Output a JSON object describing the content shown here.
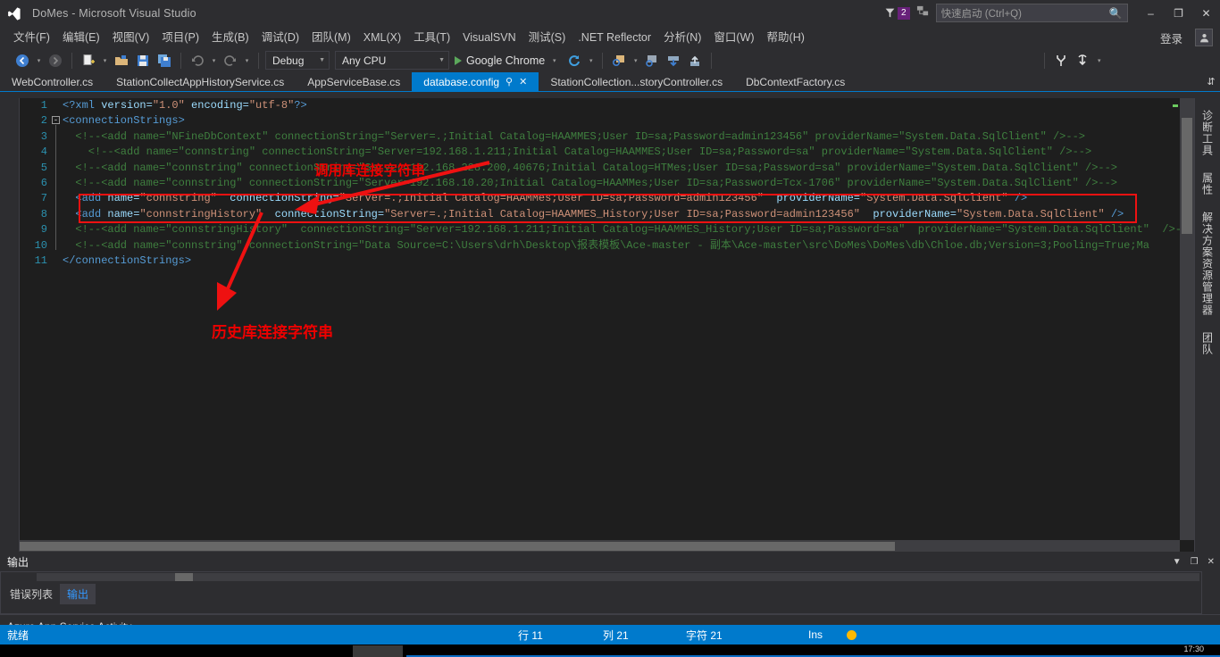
{
  "titlebar": {
    "app_title": "DoMes - Microsoft Visual Studio",
    "logo_icon": "visual-studio-logo-icon",
    "notification_count": "2",
    "notification_icon": "notification-flag-icon",
    "feedback_icon": "send-feedback-icon",
    "quick_launch_placeholder": "快速启动 (Ctrl+Q)",
    "search_icon": "magnifier-icon",
    "minimize": "–",
    "maximize": "❐",
    "close": "✕"
  },
  "menubar": {
    "items": [
      {
        "label": "文件(F)"
      },
      {
        "label": "编辑(E)"
      },
      {
        "label": "视图(V)"
      },
      {
        "label": "项目(P)"
      },
      {
        "label": "生成(B)"
      },
      {
        "label": "调试(D)"
      },
      {
        "label": "团队(M)"
      },
      {
        "label": "XML(X)"
      },
      {
        "label": "工具(T)"
      },
      {
        "label": "VisualSVN"
      },
      {
        "label": "测试(S)"
      },
      {
        "label": ".NET Reflector"
      },
      {
        "label": "分析(N)"
      },
      {
        "label": "窗口(W)"
      },
      {
        "label": "帮助(H)"
      }
    ],
    "signin_label": "登录",
    "account_icon": "account-person-icon"
  },
  "toolbar": {
    "navigate_back_icon": "navigate-back-icon",
    "navigate_forward_icon": "navigate-forward-icon",
    "new_item_icon": "new-item-icon",
    "open_file_icon": "open-file-icon",
    "save_icon": "save-icon",
    "save_all_icon": "save-all-icon",
    "undo_icon": "undo-icon",
    "redo_icon": "redo-icon",
    "config_value": "Debug",
    "platform_value": "Any CPU",
    "run_label": "Google Chrome",
    "run_icon": "play-triangle-icon",
    "refresh_icon": "refresh-circle-icon",
    "step_icon": "step-into-icon",
    "find_window_icon": "find-in-window-icon",
    "download_icon": "download-icon",
    "upload_icon": "upload-icon",
    "branch_icon": "branch-merge-icon",
    "sync_icon": "sync-arrow-icon",
    "overflow_icon": "toolbar-overflow-icon",
    "redacted_field": ""
  },
  "tabs": {
    "items": [
      {
        "label": "WebController.cs",
        "active": false
      },
      {
        "label": "StationCollectAppHistoryService.cs",
        "active": false
      },
      {
        "label": "AppServiceBase.cs",
        "active": false
      },
      {
        "label": "database.config",
        "active": true
      },
      {
        "label": "StationCollection...storyController.cs",
        "active": false
      },
      {
        "label": "DbContextFactory.cs",
        "active": false
      }
    ],
    "pin_icon": "pin-icon",
    "close_icon": "close-tab-icon",
    "overflow_icon": "tab-overflow-chevron-icon"
  },
  "editor": {
    "line_numbers": [
      "1",
      "2",
      "3",
      "4",
      "5",
      "6",
      "7",
      "8",
      "9",
      "10",
      "11"
    ],
    "lines": [
      [
        {
          "t": "<?",
          "c": "tag"
        },
        {
          "t": "xml",
          "c": "tag"
        },
        {
          "t": " version=",
          "c": "attr"
        },
        {
          "t": "\"1.0\"",
          "c": "val"
        },
        {
          "t": " encoding=",
          "c": "attr"
        },
        {
          "t": "\"utf-8\"",
          "c": "val"
        },
        {
          "t": "?>",
          "c": "tag"
        }
      ],
      [
        {
          "t": "<connectionStrings>",
          "c": "tag"
        }
      ],
      [
        {
          "t": "  <!--<add name=\"NFineDbContext\" connectionString=\"Server=.;Initial Catalog=HAAMMES;User ID=sa;Password=admin123456\" providerName=\"System.Data.SqlClient\" />-->",
          "c": "cmt"
        }
      ],
      [
        {
          "t": "    <!--<add name=\"connstring\" connectionString=\"Server=192.168.1.211;Initial Catalog=HAAMMES;User ID=sa;Password=sa\" providerName=\"System.Data.SqlClient\" />-->",
          "c": "cmt"
        }
      ],
      [
        {
          "t": "  <!--<add name=\"connstring\" connectionString=\"Server=192.168.228.200,40676;Initial Catalog=HTMes;User ID=sa;Password=sa\" providerName=\"System.Data.SqlClient\" />-->",
          "c": "cmt"
        }
      ],
      [
        {
          "t": "  <!--<add name=\"connstring\" connectionString=\"Server=192.168.10.20;Initial Catalog=HAAMMes;User ID=sa;Password=Tcx-1706\" providerName=\"System.Data.SqlClient\" />-->",
          "c": "cmt"
        }
      ],
      [
        {
          "t": "  <add ",
          "c": "tag"
        },
        {
          "t": "name=",
          "c": "attr"
        },
        {
          "t": "\"connstring\"",
          "c": "val"
        },
        {
          "t": "  connectionString=",
          "c": "attr"
        },
        {
          "t": "\"Server=.;Initial Catalog=HAAMMes;User ID=sa;Password=admin123456\"",
          "c": "val"
        },
        {
          "t": "  providerName=",
          "c": "attr"
        },
        {
          "t": "\"System.Data.SqlClient\"",
          "c": "val"
        },
        {
          "t": " />",
          "c": "tag"
        }
      ],
      [
        {
          "t": "  <add ",
          "c": "tag"
        },
        {
          "t": "name=",
          "c": "attr"
        },
        {
          "t": "\"connstringHistory\"",
          "c": "val"
        },
        {
          "t": "  connectionString=",
          "c": "attr"
        },
        {
          "t": "\"Server=.;Initial Catalog=HAAMMES_History;User ID=sa;Password=admin123456\"",
          "c": "val"
        },
        {
          "t": "  providerName=",
          "c": "attr"
        },
        {
          "t": "\"System.Data.SqlClient\"",
          "c": "val"
        },
        {
          "t": " />",
          "c": "tag"
        }
      ],
      [
        {
          "t": "  <!--<add name=\"connstringHistory\"  connectionString=\"Server=192.168.1.211;Initial Catalog=HAAMMES_History;User ID=sa;Password=sa\"  providerName=\"System.Data.SqlClient\"  />-->",
          "c": "cmt"
        }
      ],
      [
        {
          "t": "  <!--<add name=\"connstring\" connectionString=\"Data Source=C:\\Users\\drh\\Desktop\\报表模板\\Ace-master - 副本\\Ace-master\\src\\DoMes\\DoMes\\db\\Chloe.db;Version=3;Pooling=True;Ma",
          "c": "cmt"
        }
      ],
      [
        {
          "t": "</connectionStrings>",
          "c": "tag"
        }
      ]
    ],
    "fold_markers": [
      "2"
    ]
  },
  "annotations": {
    "label_current": "调用库连接字符串",
    "label_history": "历史库连接字符串",
    "highlight_color": "#ee1111",
    "text_color": "#ee0000"
  },
  "right_strip": {
    "items": [
      {
        "label": "诊断工具"
      },
      {
        "label": "属性"
      },
      {
        "label": "解决方案资源管理器"
      },
      {
        "label": "团队"
      }
    ]
  },
  "output_panel": {
    "title": "输出",
    "dropdown_icon": "chevron-down-icon",
    "float_icon": "float-window-icon",
    "close_icon": "close-panel-icon",
    "tabs": [
      {
        "label": "错误列表",
        "selected": false
      },
      {
        "label": "输出",
        "selected": true
      }
    ],
    "azure_label": "Azure App Service Activity"
  },
  "statusbar": {
    "ready": "就绪",
    "row_label": "行 11",
    "col_label": "列 21",
    "char_label": "字符 21",
    "insert_mode": "Ins",
    "indicator_icon": "status-indicator-dot",
    "indicator_color": "#ffb900"
  },
  "taskbar": {
    "clock": "17:30"
  },
  "colors": {
    "accent": "#007acc",
    "chrome": "#2d2d30",
    "editor_bg": "#1e1e1e",
    "badge": "#68217a"
  }
}
